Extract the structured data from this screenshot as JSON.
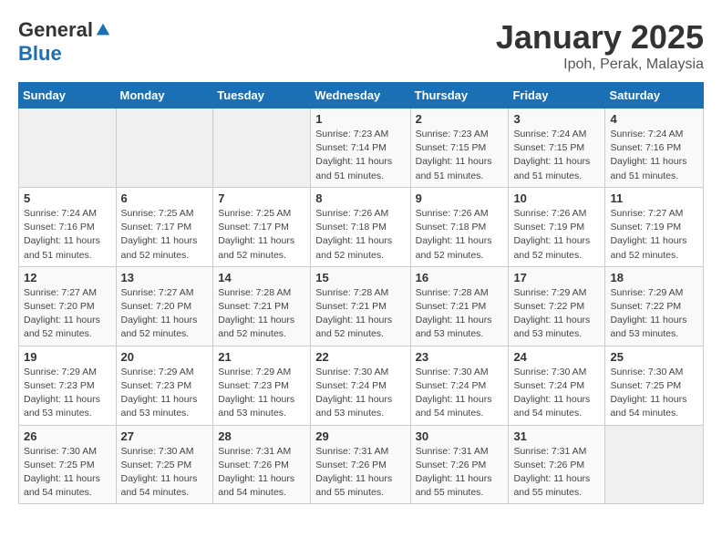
{
  "logo": {
    "general": "General",
    "blue": "Blue"
  },
  "header": {
    "title": "January 2025",
    "subtitle": "Ipoh, Perak, Malaysia"
  },
  "weekdays": [
    "Sunday",
    "Monday",
    "Tuesday",
    "Wednesday",
    "Thursday",
    "Friday",
    "Saturday"
  ],
  "weeks": [
    [
      {
        "day": "",
        "empty": true
      },
      {
        "day": "",
        "empty": true
      },
      {
        "day": "",
        "empty": true
      },
      {
        "day": "1",
        "sunrise": "7:23 AM",
        "sunset": "7:14 PM",
        "daylight": "11 hours and 51 minutes."
      },
      {
        "day": "2",
        "sunrise": "7:23 AM",
        "sunset": "7:15 PM",
        "daylight": "11 hours and 51 minutes."
      },
      {
        "day": "3",
        "sunrise": "7:24 AM",
        "sunset": "7:15 PM",
        "daylight": "11 hours and 51 minutes."
      },
      {
        "day": "4",
        "sunrise": "7:24 AM",
        "sunset": "7:16 PM",
        "daylight": "11 hours and 51 minutes."
      }
    ],
    [
      {
        "day": "5",
        "sunrise": "7:24 AM",
        "sunset": "7:16 PM",
        "daylight": "11 hours and 51 minutes."
      },
      {
        "day": "6",
        "sunrise": "7:25 AM",
        "sunset": "7:17 PM",
        "daylight": "11 hours and 52 minutes."
      },
      {
        "day": "7",
        "sunrise": "7:25 AM",
        "sunset": "7:17 PM",
        "daylight": "11 hours and 52 minutes."
      },
      {
        "day": "8",
        "sunrise": "7:26 AM",
        "sunset": "7:18 PM",
        "daylight": "11 hours and 52 minutes."
      },
      {
        "day": "9",
        "sunrise": "7:26 AM",
        "sunset": "7:18 PM",
        "daylight": "11 hours and 52 minutes."
      },
      {
        "day": "10",
        "sunrise": "7:26 AM",
        "sunset": "7:19 PM",
        "daylight": "11 hours and 52 minutes."
      },
      {
        "day": "11",
        "sunrise": "7:27 AM",
        "sunset": "7:19 PM",
        "daylight": "11 hours and 52 minutes."
      }
    ],
    [
      {
        "day": "12",
        "sunrise": "7:27 AM",
        "sunset": "7:20 PM",
        "daylight": "11 hours and 52 minutes."
      },
      {
        "day": "13",
        "sunrise": "7:27 AM",
        "sunset": "7:20 PM",
        "daylight": "11 hours and 52 minutes."
      },
      {
        "day": "14",
        "sunrise": "7:28 AM",
        "sunset": "7:21 PM",
        "daylight": "11 hours and 52 minutes."
      },
      {
        "day": "15",
        "sunrise": "7:28 AM",
        "sunset": "7:21 PM",
        "daylight": "11 hours and 52 minutes."
      },
      {
        "day": "16",
        "sunrise": "7:28 AM",
        "sunset": "7:21 PM",
        "daylight": "11 hours and 53 minutes."
      },
      {
        "day": "17",
        "sunrise": "7:29 AM",
        "sunset": "7:22 PM",
        "daylight": "11 hours and 53 minutes."
      },
      {
        "day": "18",
        "sunrise": "7:29 AM",
        "sunset": "7:22 PM",
        "daylight": "11 hours and 53 minutes."
      }
    ],
    [
      {
        "day": "19",
        "sunrise": "7:29 AM",
        "sunset": "7:23 PM",
        "daylight": "11 hours and 53 minutes."
      },
      {
        "day": "20",
        "sunrise": "7:29 AM",
        "sunset": "7:23 PM",
        "daylight": "11 hours and 53 minutes."
      },
      {
        "day": "21",
        "sunrise": "7:29 AM",
        "sunset": "7:23 PM",
        "daylight": "11 hours and 53 minutes."
      },
      {
        "day": "22",
        "sunrise": "7:30 AM",
        "sunset": "7:24 PM",
        "daylight": "11 hours and 53 minutes."
      },
      {
        "day": "23",
        "sunrise": "7:30 AM",
        "sunset": "7:24 PM",
        "daylight": "11 hours and 54 minutes."
      },
      {
        "day": "24",
        "sunrise": "7:30 AM",
        "sunset": "7:24 PM",
        "daylight": "11 hours and 54 minutes."
      },
      {
        "day": "25",
        "sunrise": "7:30 AM",
        "sunset": "7:25 PM",
        "daylight": "11 hours and 54 minutes."
      }
    ],
    [
      {
        "day": "26",
        "sunrise": "7:30 AM",
        "sunset": "7:25 PM",
        "daylight": "11 hours and 54 minutes."
      },
      {
        "day": "27",
        "sunrise": "7:30 AM",
        "sunset": "7:25 PM",
        "daylight": "11 hours and 54 minutes."
      },
      {
        "day": "28",
        "sunrise": "7:31 AM",
        "sunset": "7:26 PM",
        "daylight": "11 hours and 54 minutes."
      },
      {
        "day": "29",
        "sunrise": "7:31 AM",
        "sunset": "7:26 PM",
        "daylight": "11 hours and 55 minutes."
      },
      {
        "day": "30",
        "sunrise": "7:31 AM",
        "sunset": "7:26 PM",
        "daylight": "11 hours and 55 minutes."
      },
      {
        "day": "31",
        "sunrise": "7:31 AM",
        "sunset": "7:26 PM",
        "daylight": "11 hours and 55 minutes."
      },
      {
        "day": "",
        "empty": true
      }
    ]
  ],
  "labels": {
    "sunrise": "Sunrise:",
    "sunset": "Sunset:",
    "daylight": "Daylight:"
  }
}
